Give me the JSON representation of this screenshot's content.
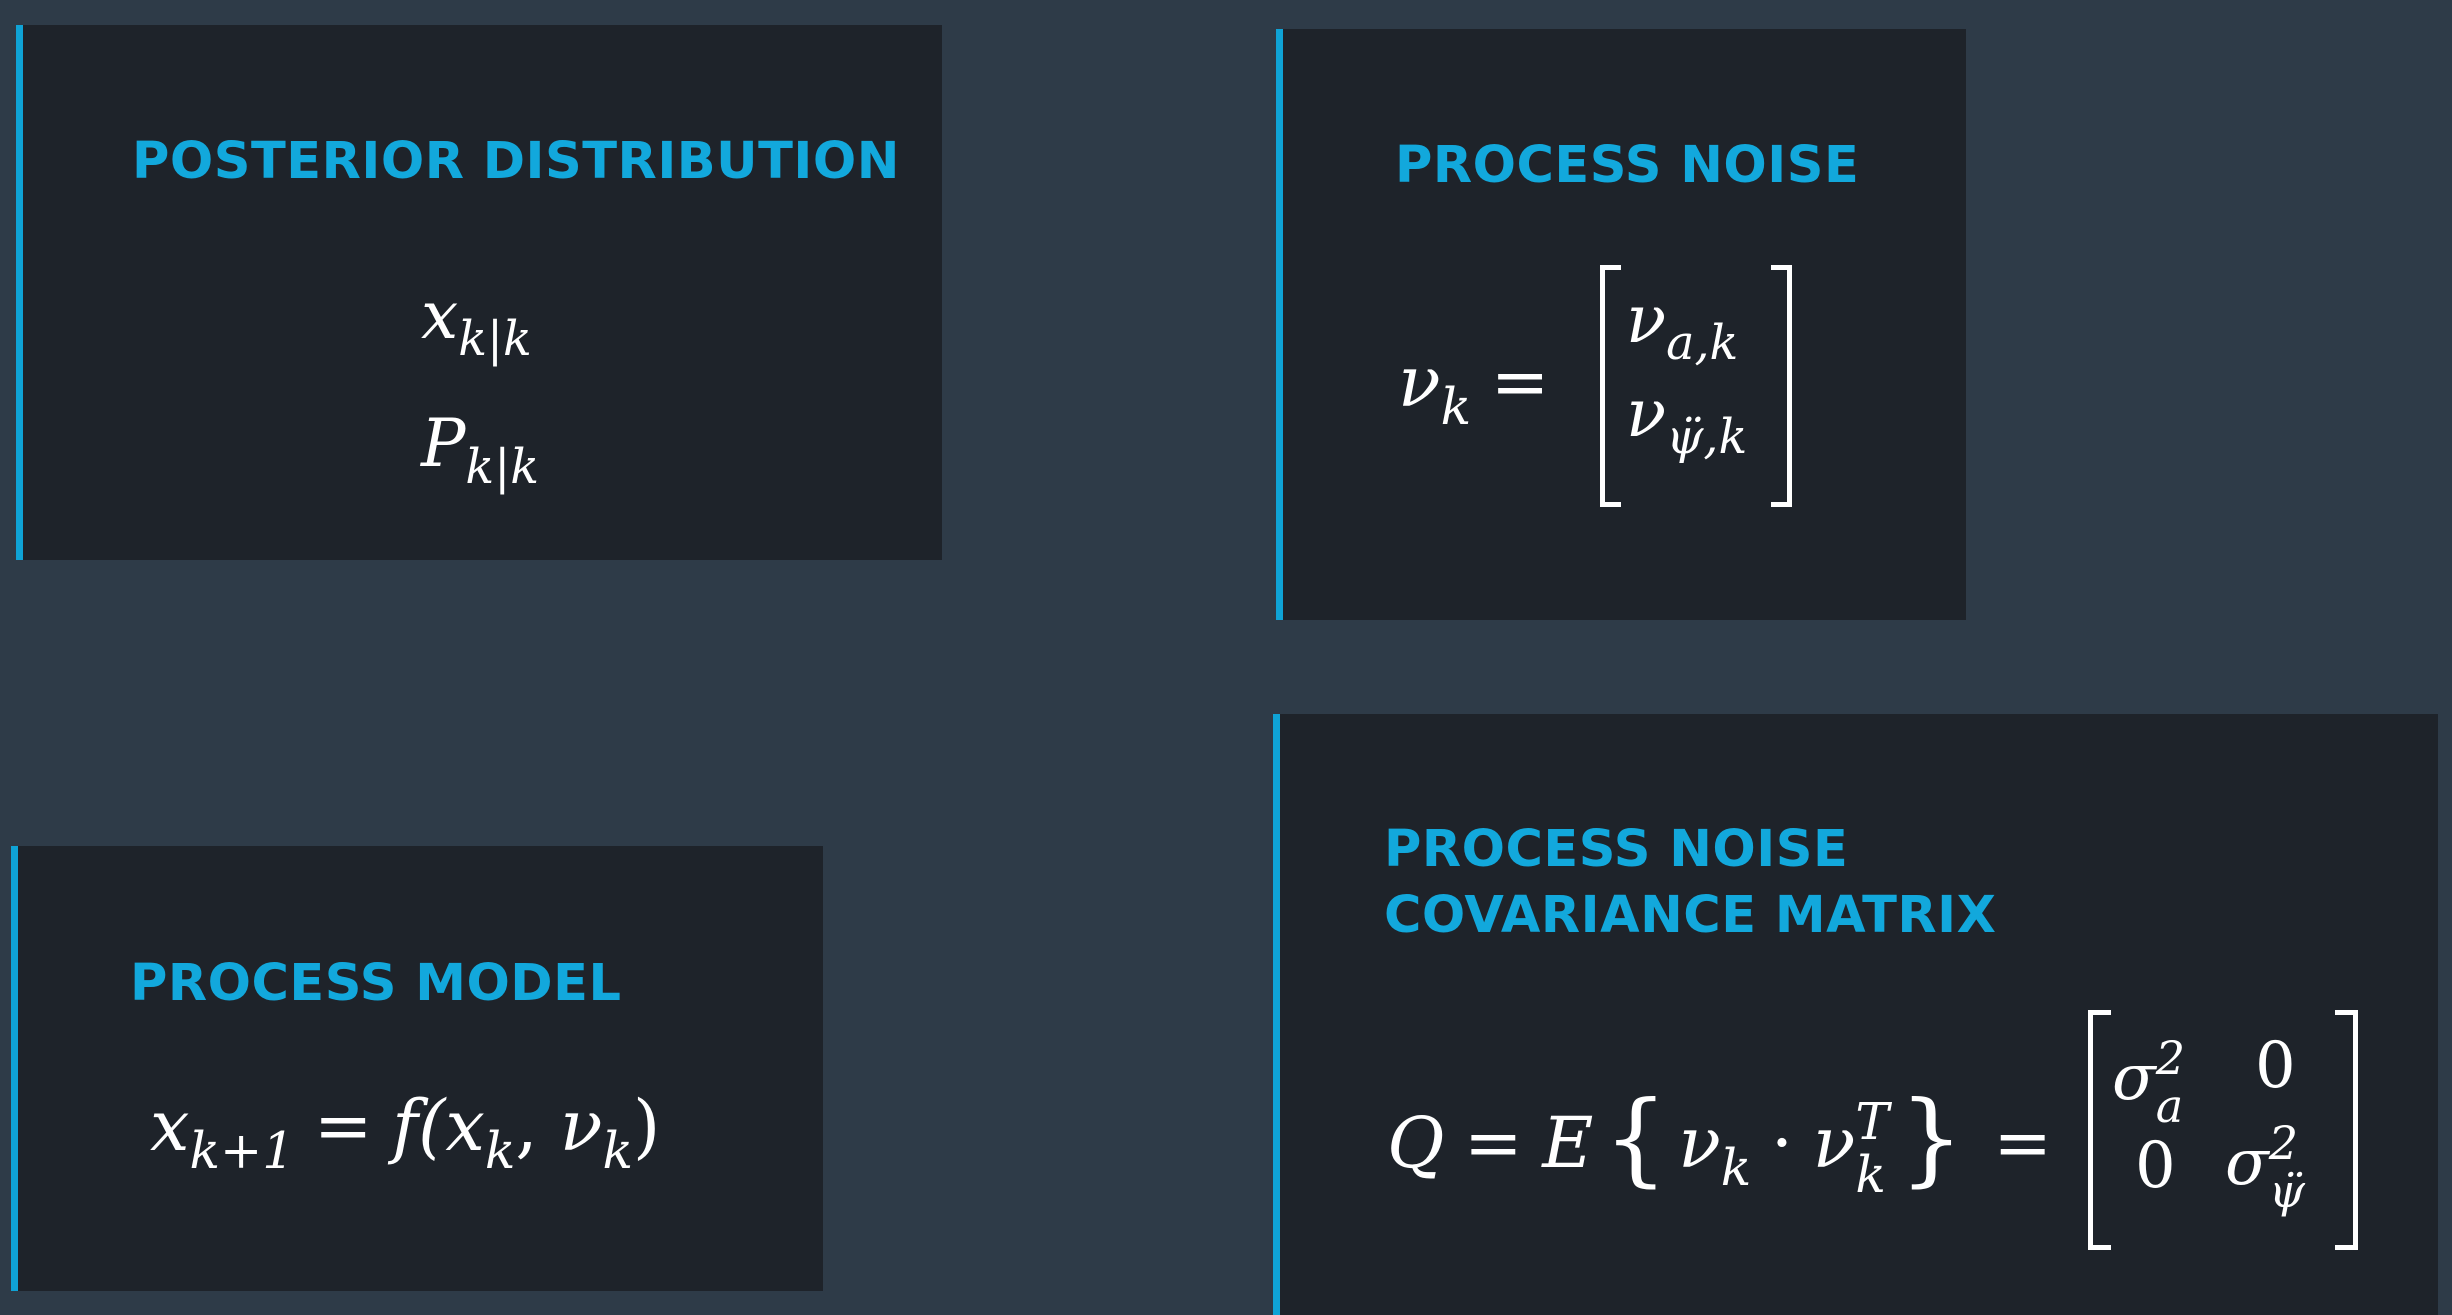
{
  "posterior": {
    "title": "POSTERIOR DISTRIBUTION",
    "x_base": "x",
    "x_sub": "k|k",
    "p_base": "P",
    "p_sub": "k|k"
  },
  "noise": {
    "title": "PROCESS NOISE",
    "lhs_base": "ν",
    "lhs_sub": "k",
    "equals": "=",
    "row1_base": "ν",
    "row1_sub": "a,k",
    "row2_base": "ν",
    "row2_sub": "ψ̈,k"
  },
  "model": {
    "title": "PROCESS MODEL",
    "lhs_base": "x",
    "lhs_sub": "k+1",
    "equals": "=",
    "func": "f(",
    "arg1_base": "x",
    "arg1_sub": "k",
    "comma": ", ",
    "arg2_base": "ν",
    "arg2_sub": "k",
    "close": ")"
  },
  "covariance": {
    "title_line1": "PROCESS NOISE",
    "title_line2": "COVARIANCE MATRIX",
    "q": "Q",
    "equals1": "=",
    "e": "E",
    "lbrace": "{",
    "v1_base": "ν",
    "v1_sub": "k",
    "dot": "·",
    "v2_base": "ν",
    "v2_sub": "k",
    "v2_sup": "T",
    "rbrace": "}",
    "equals2": "=",
    "m11_base": "σ",
    "m11_sub": "a",
    "m11_sup": "2",
    "m12": "0",
    "m21": "0",
    "m22_base": "σ",
    "m22_sub": "ψ̈",
    "m22_sup": "2"
  },
  "colors": {
    "background": "#2e3b48",
    "card": "#1e232a",
    "accent": "#12a8dc",
    "math": "#ffffff"
  }
}
